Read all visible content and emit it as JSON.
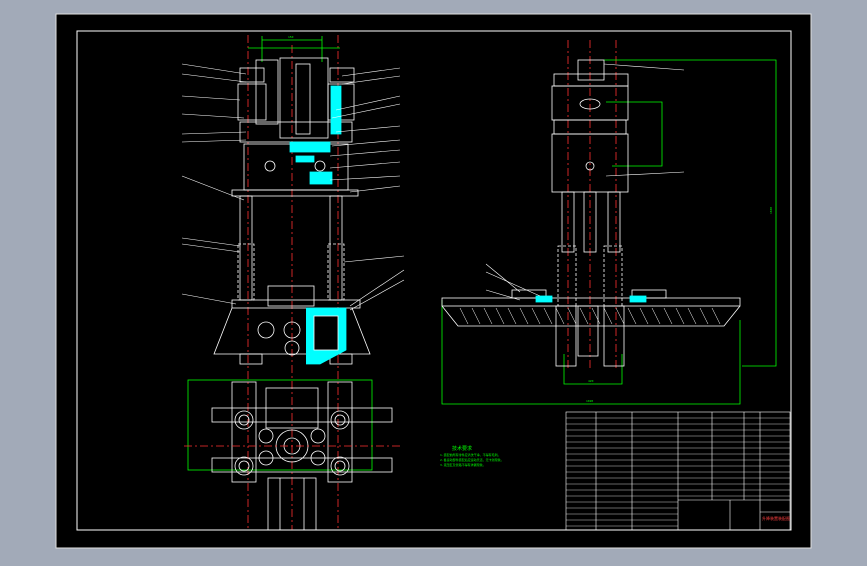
{
  "drawing": {
    "background": "#000000",
    "frame_color": "#ffffff",
    "colors": {
      "outline": "#ffffff",
      "centerline": "#ff3030",
      "dimension": "#00ff00",
      "fill": "#00ffff",
      "leader": "#ffffff",
      "notes": "#00ff00",
      "title_text": "#ff4040"
    },
    "tech_notes": {
      "title": "技术要求",
      "lines": [
        "1.装配前所有零件应清洗干净，不得有毛刺。",
        "2.各运动部件装配后应运动灵活，无卡滞现象。",
        "3.液压缸及管路不得有渗漏现象。"
      ]
    },
    "dimensions": {
      "top_width": "150",
      "lower_width": "420",
      "overall_width": "1020",
      "overall_height": "1600"
    },
    "title_block": {
      "drawing_name": "升降装置装配图",
      "headers": [
        "序号",
        "代号",
        "名称",
        "数量",
        "材料",
        "备注"
      ]
    }
  }
}
